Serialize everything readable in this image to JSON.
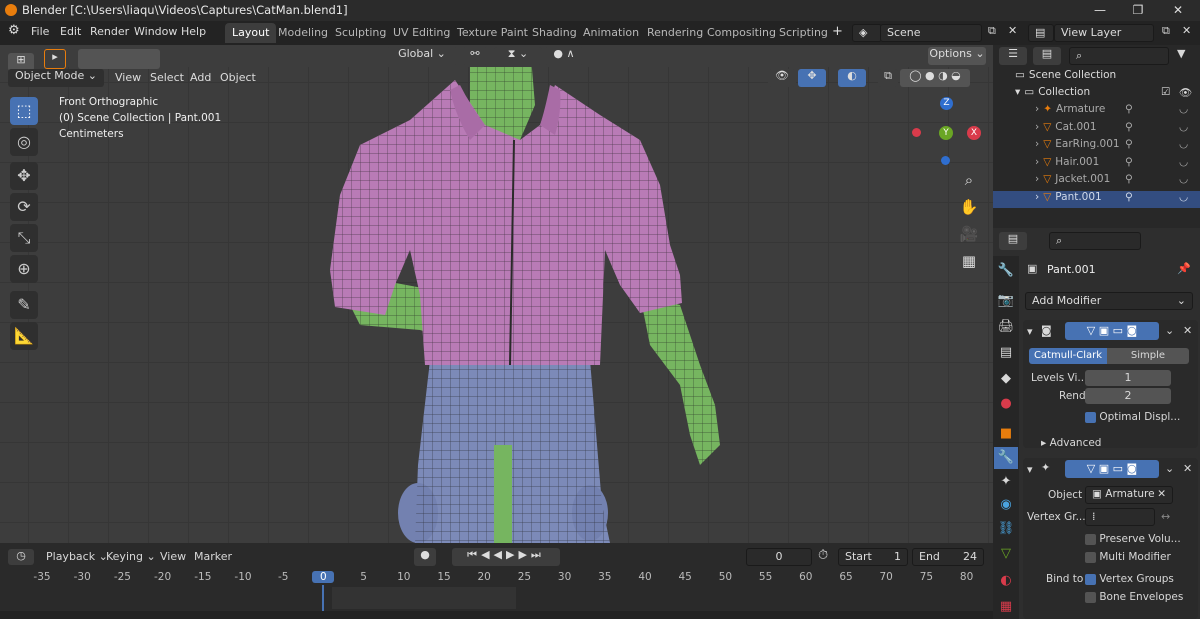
{
  "titlebar": {
    "title": "Blender [C:\\Users\\liaqu\\Videos\\Captures\\CatMan.blend1]"
  },
  "menu": {
    "file": "File",
    "edit": "Edit",
    "render": "Render",
    "window": "Window",
    "help": "Help"
  },
  "workspaces": [
    "Layout",
    "Modeling",
    "Sculpting",
    "UV Editing",
    "Texture Paint",
    "Shading",
    "Animation",
    "Rendering",
    "Compositing",
    "Scripting"
  ],
  "scene": {
    "name": "Scene",
    "view_layer": "View Layer"
  },
  "viewport": {
    "mode": "Object Mode",
    "menus": [
      "View",
      "Select",
      "Add",
      "Object"
    ],
    "orientation": "Global",
    "options": "Options",
    "overlay": {
      "view": "Front Orthographic",
      "collection": "(0) Scene Collection | Pant.001",
      "units": "Centimeters"
    },
    "axes": {
      "z": "Z",
      "y": "Y",
      "x": "X"
    }
  },
  "timeline": {
    "playback": "Playback",
    "keying": "Keying",
    "view": "View",
    "marker": "Marker",
    "current_frame": "0",
    "start_label": "Start",
    "start": "1",
    "end_label": "End",
    "end": "24",
    "ticks": [
      "-35",
      "-30",
      "-25",
      "-20",
      "-15",
      "-10",
      "-5",
      "0",
      "5",
      "10",
      "15",
      "20",
      "25",
      "30",
      "35",
      "40",
      "45",
      "50",
      "55",
      "60",
      "65",
      "70",
      "75",
      "80"
    ]
  },
  "outliner": {
    "root": "Scene Collection",
    "collection": "Collection",
    "items": [
      "Armature",
      "Cat.001",
      "EarRing.001",
      "Hair.001",
      "Jacket.001",
      "Pant.001"
    ]
  },
  "properties": {
    "object": "Pant.001",
    "add_modifier": "Add Modifier",
    "subsurf": {
      "catmull": "Catmull-Clark",
      "simple": "Simple",
      "levels_label": "Levels Vi...",
      "levels": "1",
      "render_label": "Render",
      "render": "2",
      "optimal": "Optimal Displ...",
      "advanced": "Advanced"
    },
    "armature_mod": {
      "object_label": "Object",
      "object": "Armature",
      "vgroup_label": "Vertex Gr...",
      "preserve": "Preserve Volu...",
      "multi": "Multi Modifier",
      "bind_label": "Bind to",
      "vertex_groups": "Vertex Groups",
      "bone_env": "Bone Envelopes"
    }
  },
  "colors": {
    "accent": "#4772b3",
    "shirt": "#b97bb6",
    "jeans": "#7c8ab8",
    "skin": "#76b560"
  }
}
